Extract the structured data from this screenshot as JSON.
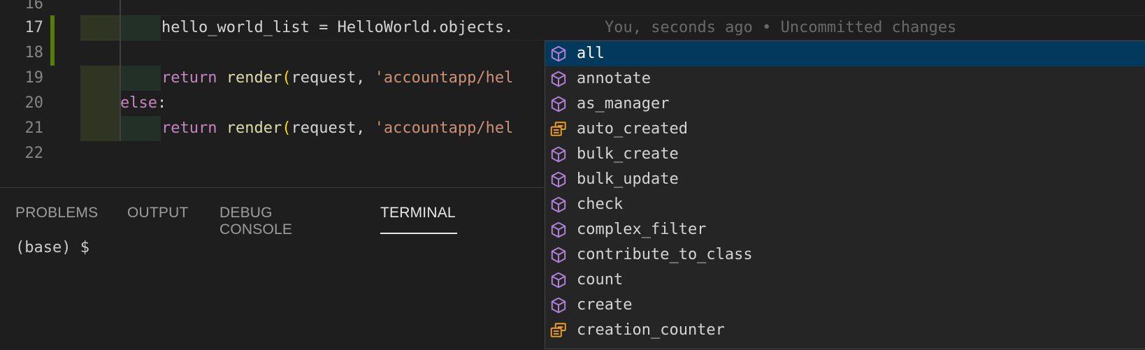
{
  "editor": {
    "lines": [
      {
        "number": "16",
        "text": ""
      },
      {
        "number": "17",
        "text": "hello_world_list = HelloWorld.objects."
      },
      {
        "number": "18",
        "text": ""
      },
      {
        "number": "19",
        "kw": "return",
        "fn": "render",
        "open": "(",
        "args": "request, ",
        "str": "'accountapp/hel"
      },
      {
        "number": "20",
        "kw": "else",
        "rest": ":"
      },
      {
        "number": "21",
        "kw": "return",
        "fn": "render",
        "open": "(",
        "args": "request, ",
        "str": "'accountapp/hel"
      },
      {
        "number": "22",
        "text": ""
      }
    ],
    "blame": "You, seconds ago • Uncommitted changes"
  },
  "panel": {
    "tabs": [
      "PROBLEMS",
      "OUTPUT",
      "DEBUG CONSOLE",
      "TERMINAL"
    ],
    "active_tab": "TERMINAL",
    "terminal_prompt": "(base) $"
  },
  "suggestions": {
    "selected": "all",
    "items": [
      {
        "label": "all",
        "icon": "method-cube-icon"
      },
      {
        "label": "annotate",
        "icon": "method-cube-icon"
      },
      {
        "label": "as_manager",
        "icon": "method-cube-icon"
      },
      {
        "label": "auto_created",
        "icon": "field-icon"
      },
      {
        "label": "bulk_create",
        "icon": "method-cube-icon"
      },
      {
        "label": "bulk_update",
        "icon": "method-cube-icon"
      },
      {
        "label": "check",
        "icon": "method-cube-icon"
      },
      {
        "label": "complex_filter",
        "icon": "method-cube-icon"
      },
      {
        "label": "contribute_to_class",
        "icon": "method-cube-icon"
      },
      {
        "label": "count",
        "icon": "method-cube-icon"
      },
      {
        "label": "create",
        "icon": "method-cube-icon"
      },
      {
        "label": "creation_counter",
        "icon": "field-icon"
      }
    ]
  },
  "colors": {
    "keyword": "#c586c0",
    "function": "#dcdcaa",
    "string": "#ce9178",
    "bracket": "#ffd700",
    "method_icon": "#b180d7",
    "field_icon": "#ee9d28",
    "selection": "#04395e",
    "git_added": "#587c0c"
  }
}
